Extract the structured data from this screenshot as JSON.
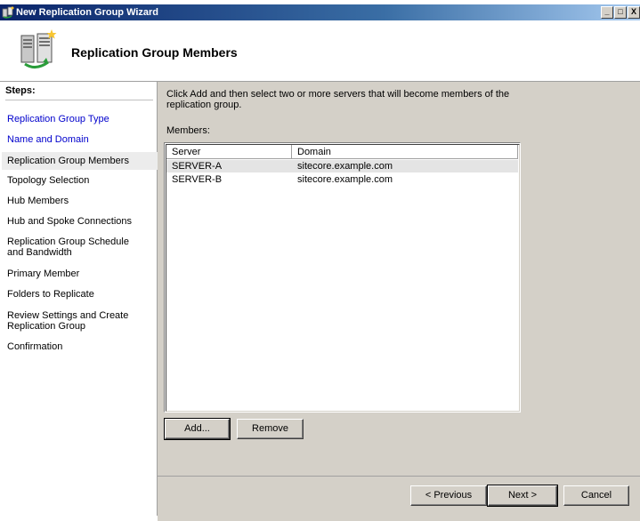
{
  "window": {
    "title": "New Replication Group Wizard",
    "buttons": [
      "_",
      "□",
      "X"
    ]
  },
  "header": {
    "title": "Replication Group Members",
    "icon": "replication-servers-icon"
  },
  "steps": {
    "title": "Steps:",
    "items": [
      {
        "label": "Replication Group Type",
        "state": "link"
      },
      {
        "label": "Name and Domain",
        "state": "link"
      },
      {
        "label": "Replication Group Members",
        "state": "current"
      },
      {
        "label": "Topology Selection",
        "state": "pending"
      },
      {
        "label": "Hub Members",
        "state": "pending"
      },
      {
        "label": "Hub and Spoke Connections",
        "state": "pending"
      },
      {
        "label": "Replication Group Schedule and Bandwidth",
        "state": "pending"
      },
      {
        "label": "Primary Member",
        "state": "pending"
      },
      {
        "label": "Folders to Replicate",
        "state": "pending"
      },
      {
        "label": "Review Settings and Create Replication Group",
        "state": "pending"
      },
      {
        "label": "Confirmation",
        "state": "pending"
      }
    ]
  },
  "content": {
    "intro": "Click Add and then select two or more servers that will become members of the replication group.",
    "members_label": "Members:",
    "columns": [
      "Server",
      "Domain"
    ],
    "rows": [
      {
        "server": "SERVER-A",
        "domain": "sitecore.example.com",
        "selected": true
      },
      {
        "server": "SERVER-B",
        "domain": "sitecore.example.com",
        "selected": false
      }
    ],
    "add_label": "Add...",
    "remove_label": "Remove"
  },
  "footer": {
    "previous_label": "< Previous",
    "next_label": "Next >",
    "cancel_label": "Cancel"
  }
}
